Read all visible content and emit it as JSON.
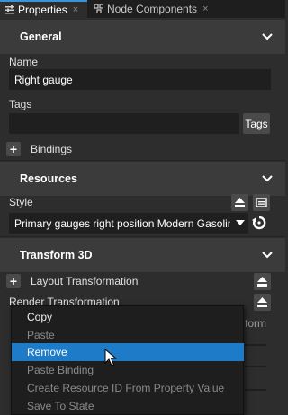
{
  "tabs": [
    {
      "label": "Properties",
      "close": "×"
    },
    {
      "label": "Node Components",
      "close": "×"
    }
  ],
  "sections": {
    "general": "General",
    "resources": "Resources",
    "transform": "Transform 3D"
  },
  "general": {
    "name_label": "Name",
    "name_value": "Right gauge",
    "tags_label": "Tags",
    "tags_value": "",
    "tags_button": "Tags",
    "bindings_plus": "+",
    "bindings_label": "Bindings"
  },
  "resources": {
    "style_label": "Style",
    "style_value": "Primary gauges right position Modern Gasoline"
  },
  "transform": {
    "layout_plus": "+",
    "layout_label": "Layout Transformation",
    "render_label": "Render Transformation",
    "partial_text": "form"
  },
  "context_menu": {
    "items": [
      {
        "label": "Copy",
        "enabled": true
      },
      {
        "label": "Paste",
        "enabled": false
      },
      {
        "label": "Remove",
        "enabled": true,
        "highlighted": true
      },
      {
        "label": "Paste Binding",
        "enabled": false
      },
      {
        "label": "Create Resource ID From Property Value",
        "enabled": false
      },
      {
        "label": "Save To State",
        "enabled": false
      }
    ]
  },
  "colors": {
    "accent": "#3a93d8",
    "highlight": "#1e7bc7",
    "panel": "#2d2d2d",
    "section": "#3b3b3b",
    "field": "#1f1f1f"
  },
  "icons": [
    "properties-tab-icon",
    "node-components-icon",
    "chevron-down-icon",
    "upload-icon",
    "resource-icon",
    "reset-icon",
    "mouse-cursor-icon"
  ]
}
